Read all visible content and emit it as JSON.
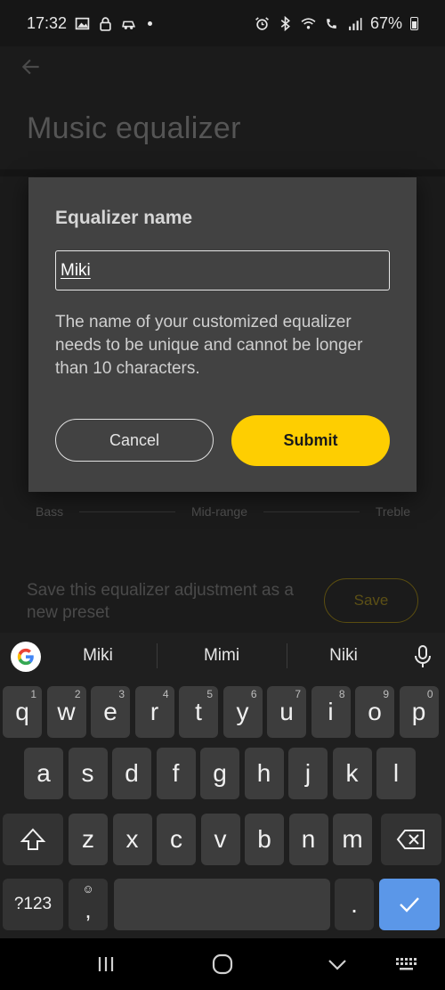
{
  "status_bar": {
    "time": "17:32",
    "battery_percent": "67%",
    "left_icons": [
      "image-icon",
      "lock-icon",
      "car-icon"
    ],
    "right_icons": [
      "alarm-icon",
      "bluetooth-icon",
      "wifi-icon",
      "call-signal-icon",
      "signal-bars-icon",
      "battery-icon"
    ]
  },
  "header": {
    "title": "Music equalizer"
  },
  "range_labels": {
    "low": "Bass",
    "mid": "Mid-range",
    "high": "Treble"
  },
  "save_section": {
    "text": "Save this equalizer adjustment as a new preset",
    "button": "Save"
  },
  "dialog": {
    "title": "Equalizer name",
    "input_value": "Miki",
    "description": "The name of your customized equalizer needs to be unique and cannot be longer than 10 characters.",
    "cancel": "Cancel",
    "submit": "Submit"
  },
  "keyboard": {
    "suggestions": [
      "Miki",
      "Mimi",
      "Niki"
    ],
    "row1": [
      {
        "k": "q",
        "h": "1"
      },
      {
        "k": "w",
        "h": "2"
      },
      {
        "k": "e",
        "h": "3"
      },
      {
        "k": "r",
        "h": "4"
      },
      {
        "k": "t",
        "h": "5"
      },
      {
        "k": "y",
        "h": "6"
      },
      {
        "k": "u",
        "h": "7"
      },
      {
        "k": "i",
        "h": "8"
      },
      {
        "k": "o",
        "h": "9"
      },
      {
        "k": "p",
        "h": "0"
      }
    ],
    "row2": [
      "a",
      "s",
      "d",
      "f",
      "g",
      "h",
      "j",
      "k",
      "l"
    ],
    "row3": [
      "z",
      "x",
      "c",
      "v",
      "b",
      "n",
      "m"
    ],
    "symbols": "?123",
    "emoji_comma": ",",
    "period": ".",
    "accent_color": "#5b97e8"
  },
  "colors": {
    "submit_yellow": "#fece01",
    "dialog_bg": "#424242"
  }
}
